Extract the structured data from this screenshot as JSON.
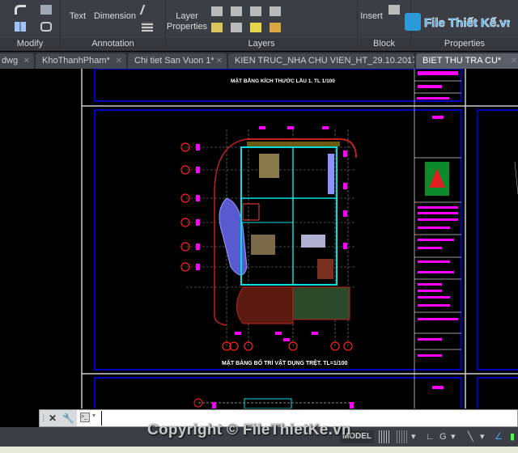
{
  "ribbon": {
    "panels": [
      {
        "label": "Modify"
      },
      {
        "label": "Annotation"
      },
      {
        "label": "Layers"
      },
      {
        "label": "Block"
      },
      {
        "label": "Properties"
      }
    ],
    "buttons": {
      "text": "Text",
      "dimension": "Dimension",
      "layer_properties_1": "Layer",
      "layer_properties_2": "Properties",
      "insert": "Insert"
    }
  },
  "watermark": {
    "logo": "File Thiết Kế.vn",
    "copyright": "Copyright © FileThietKe.vn"
  },
  "tabs": [
    {
      "label": "dwg",
      "active": false
    },
    {
      "label": "KhoThanhPham*",
      "active": false
    },
    {
      "label": "Chi tiet San Vuon 1*",
      "active": false
    },
    {
      "label": "KIEN TRUC_NHA CHU VIEN_HT_29.10.2017*",
      "active": false
    },
    {
      "label": "BIET THU TRA CU*",
      "active": true
    }
  ],
  "drawing": {
    "top_title": "MẶT BẰNG KÍCH THƯỚC LẦU 1. TL 1/100",
    "main_title": "MẶT BẰNG BỐ TRÍ VẬT DỤNG TRỆT. TL=1/100",
    "colors": {
      "frame": "#0000ff",
      "title_text": "#ff00ff",
      "wall": "#00ffff",
      "axis": "#ff0000"
    }
  },
  "command": {
    "value": "",
    "placeholder": ""
  },
  "status": {
    "model": "MODEL"
  }
}
